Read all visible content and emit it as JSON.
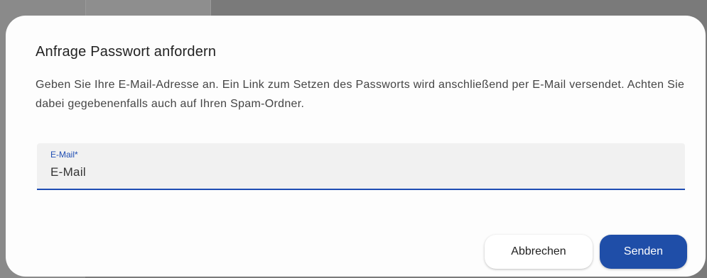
{
  "dialog": {
    "title": "Anfrage Passwort anfordern",
    "description": "Geben Sie Ihre E-Mail-Adresse an. Ein Link zum Setzen des Passworts wird anschließend per E-Mail versendet. Achten Sie dabei gegebenenfalls auch auf Ihren Spam-Ordner.",
    "email_field": {
      "label": "E-Mail*",
      "placeholder": "E-Mail"
    },
    "buttons": {
      "cancel_label": "Abbrechen",
      "send_label": "Senden"
    }
  },
  "colors": {
    "accent": "#1e4db3",
    "primary_button": "#1f4ea8",
    "dialog_background": "#fdfdfd",
    "field_background": "#f1f1f1",
    "backdrop": "#7a7a7a"
  }
}
